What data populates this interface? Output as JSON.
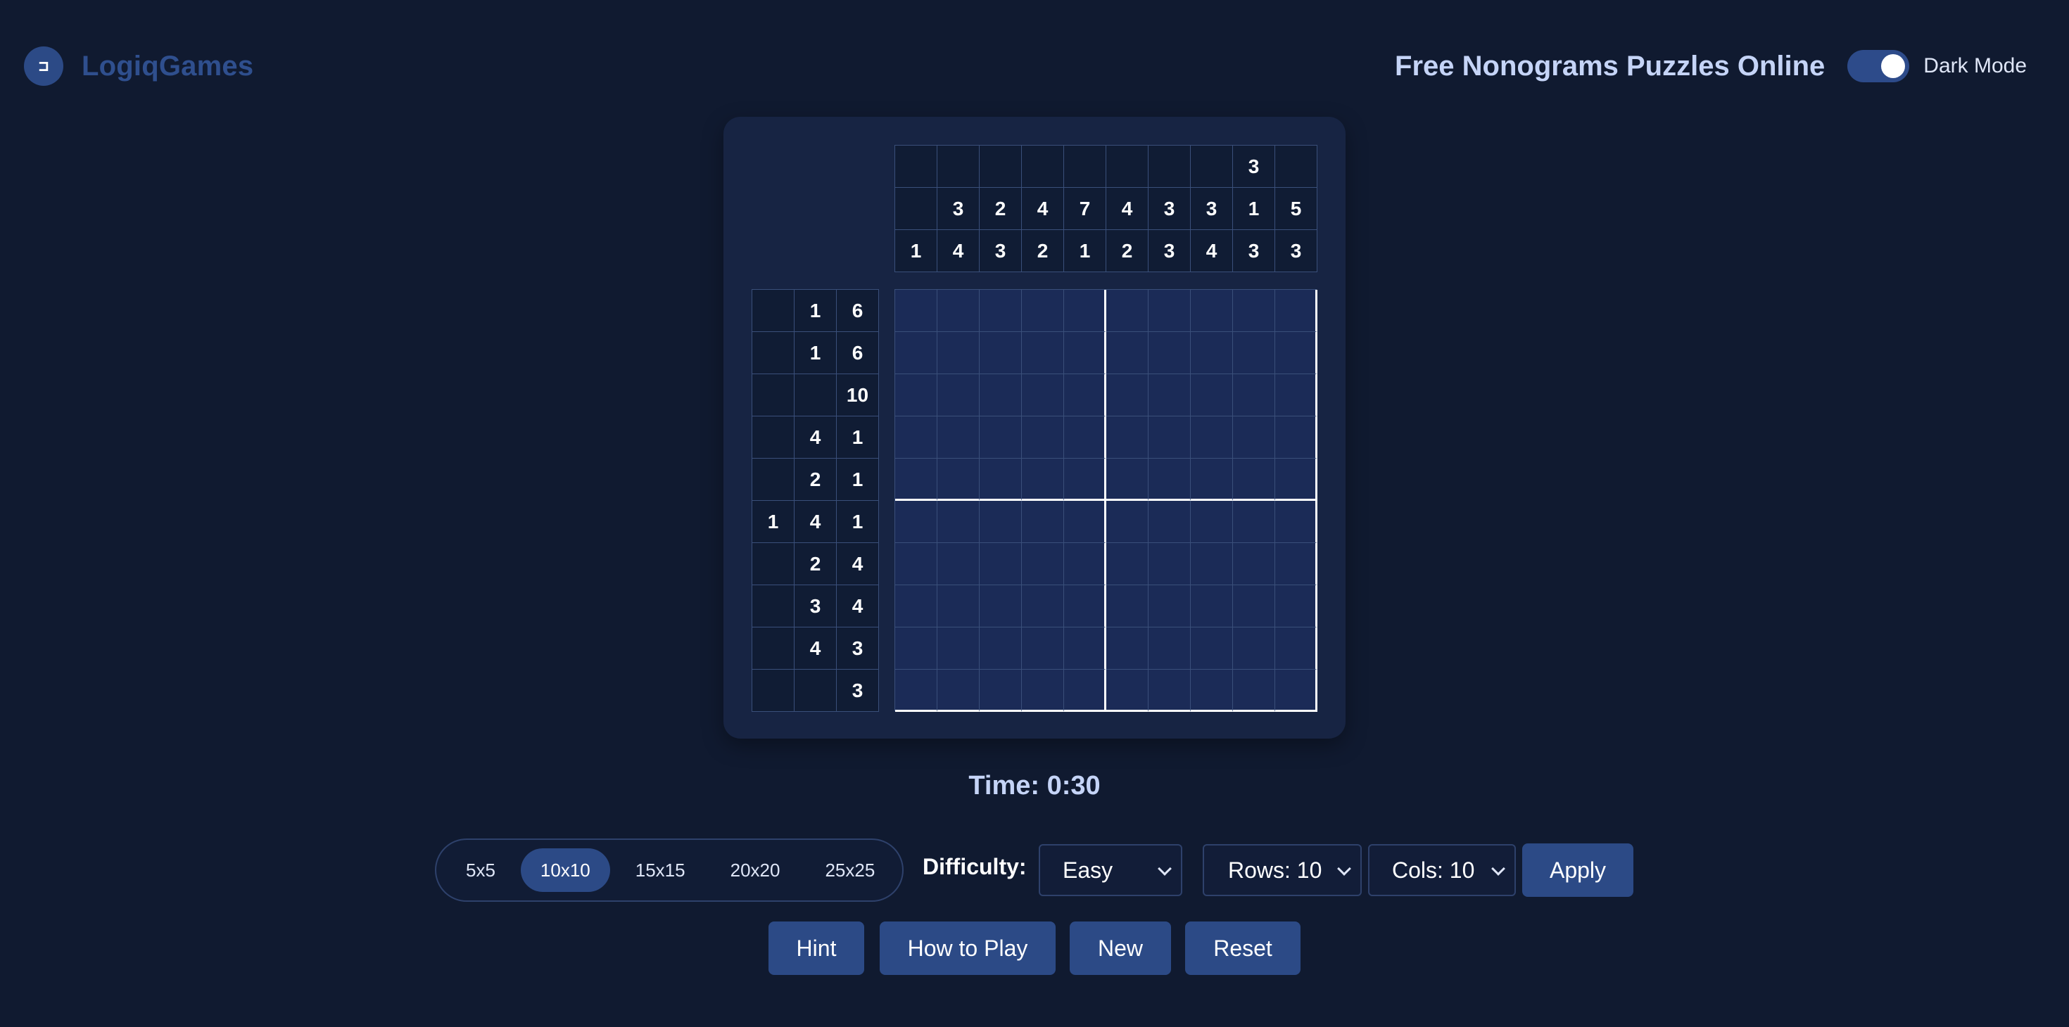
{
  "header": {
    "brand_icon_glyph": "⊐",
    "brand_name": "LogiqGames",
    "site_title": "Free Nonograms Puzzles Online",
    "dark_mode_label": "Dark Mode",
    "dark_mode_on": true
  },
  "puzzle": {
    "size": "10x10",
    "column_clues": [
      [
        "",
        "",
        "",
        "",
        "",
        "",
        "",
        "",
        "3",
        ""
      ],
      [
        "",
        "3",
        "2",
        "4",
        "7",
        "4",
        "3",
        "3",
        "1",
        "5"
      ],
      [
        "1",
        "4",
        "3",
        "2",
        "1",
        "2",
        "3",
        "4",
        "3",
        "3"
      ]
    ],
    "row_clues": [
      [
        "",
        "1",
        "6"
      ],
      [
        "",
        "1",
        "6"
      ],
      [
        "",
        "",
        "10"
      ],
      [
        "",
        "4",
        "1"
      ],
      [
        "",
        "2",
        "1"
      ],
      [
        "1",
        "4",
        "1"
      ],
      [
        "",
        "2",
        "4"
      ],
      [
        "",
        "3",
        "4"
      ],
      [
        "",
        "4",
        "3"
      ],
      [
        "",
        "",
        "3"
      ]
    ]
  },
  "timer": {
    "text": "Time: 0:30"
  },
  "controls": {
    "sizes": [
      "5x5",
      "10x10",
      "15x15",
      "20x20",
      "25x25"
    ],
    "active_size": "10x10",
    "difficulty_label": "Difficulty:",
    "difficulty_value": "Easy",
    "rows_value": "Rows: 10",
    "cols_value": "Cols: 10",
    "apply_label": "Apply",
    "hint_label": "Hint",
    "how_to_play_label": "How to Play",
    "new_label": "New",
    "reset_label": "Reset"
  },
  "colors": {
    "background": "#101a30",
    "panel": "#172443",
    "accent": "#2c4a86",
    "grid_cell": "#1b2b57"
  }
}
